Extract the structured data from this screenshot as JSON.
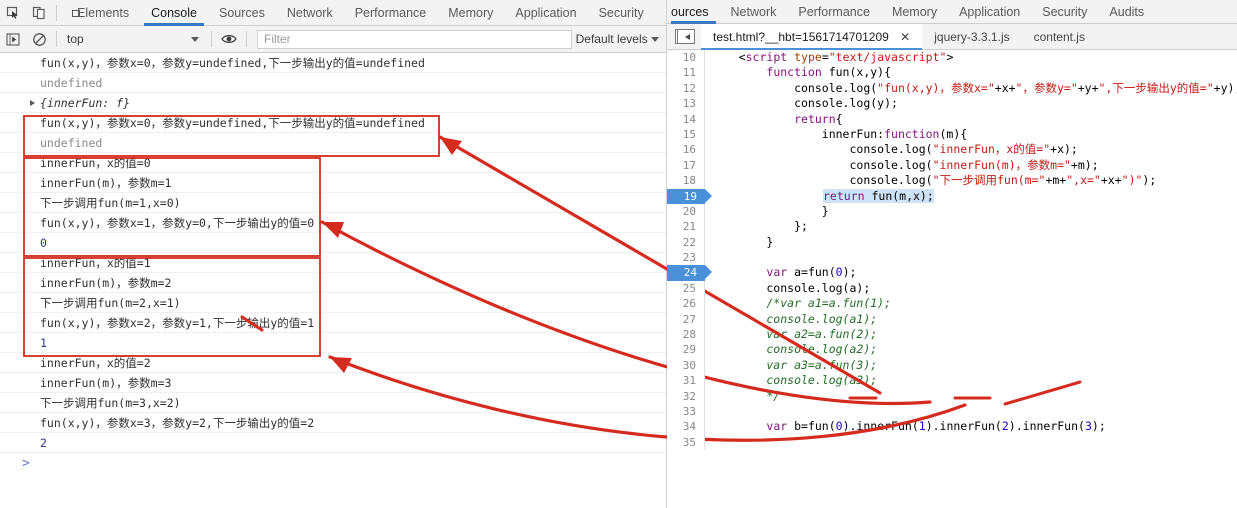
{
  "devtools": {
    "left_panel": {
      "toolbar_icons": [
        "inspect-element-icon",
        "device-toolbar-icon"
      ],
      "tabs": [
        {
          "label": "Elements",
          "active": false
        },
        {
          "label": "Console",
          "active": true
        },
        {
          "label": "Sources",
          "active": false
        },
        {
          "label": "Network",
          "active": false
        },
        {
          "label": "Performance",
          "active": false
        },
        {
          "label": "Memory",
          "active": false
        },
        {
          "label": "Application",
          "active": false
        },
        {
          "label": "Security",
          "active": false
        }
      ],
      "console_toolbar": {
        "context": "top",
        "filter_placeholder": "Filter",
        "filter_value": "",
        "levels": "Default levels"
      },
      "console_rows": [
        {
          "text": "fun(x,y)，参数x=0，参数y=undefined,下一步输出y的值=undefined",
          "kind": "log"
        },
        {
          "text": "undefined",
          "kind": "dim"
        },
        {
          "text": "{innerFun: f}",
          "kind": "object"
        },
        {
          "text": "fun(x,y)，参数x=0，参数y=undefined,下一步输出y的值=undefined",
          "kind": "log"
        },
        {
          "text": "undefined",
          "kind": "dim"
        },
        {
          "text": "innerFun，x的值=0",
          "kind": "log"
        },
        {
          "text": "innerFun(m)，参数m=1",
          "kind": "log"
        },
        {
          "text": "下一步调用fun(m=1,x=0)",
          "kind": "log"
        },
        {
          "text": "fun(x,y)，参数x=1，参数y=0,下一步输出y的值=0",
          "kind": "log"
        },
        {
          "text": "0",
          "kind": "value"
        },
        {
          "text": "innerFun，x的值=1",
          "kind": "log"
        },
        {
          "text": "innerFun(m)，参数m=2",
          "kind": "log"
        },
        {
          "text": "下一步调用fun(m=2,x=1)",
          "kind": "log"
        },
        {
          "text": "fun(x,y)，参数x=2，参数y=1,下一步输出y的值=1",
          "kind": "log"
        },
        {
          "text": "1",
          "kind": "value"
        },
        {
          "text": "innerFun，x的值=2",
          "kind": "log"
        },
        {
          "text": "innerFun(m)，参数m=3",
          "kind": "log"
        },
        {
          "text": "下一步调用fun(m=3,x=2)",
          "kind": "log"
        },
        {
          "text": "fun(x,y)，参数x=3，参数y=2,下一步输出y的值=2",
          "kind": "log"
        },
        {
          "text": "2",
          "kind": "value"
        }
      ],
      "console_prompt": ">"
    },
    "right_panel": {
      "tabs": [
        {
          "label": "ources",
          "active": true
        },
        {
          "label": "Network",
          "active": false
        },
        {
          "label": "Performance",
          "active": false
        },
        {
          "label": "Memory",
          "active": false
        },
        {
          "label": "Application",
          "active": false
        },
        {
          "label": "Security",
          "active": false
        },
        {
          "label": "Audits",
          "active": false
        }
      ],
      "file_tabs": [
        {
          "label": "test.html?__hbt=1561714701209",
          "active": true,
          "closable": true
        },
        {
          "label": "jquery-3.3.1.js",
          "active": false,
          "closable": false
        },
        {
          "label": "content.js",
          "active": false,
          "closable": false
        }
      ],
      "close_glyph": "✕",
      "code_lines": [
        {
          "n": "10",
          "text": "    <script type=\"text/javascript\">",
          "bp": false
        },
        {
          "n": "11",
          "text": "        function fun(x,y){",
          "bp": false
        },
        {
          "n": "12",
          "text": "            console.log(\"fun(x,y)，参数x=\"+x+\"，参数y=\"+y+\",下一步输出y的值=\"+y);",
          "bp": false
        },
        {
          "n": "13",
          "text": "            console.log(y);",
          "bp": false
        },
        {
          "n": "14",
          "text": "            return{",
          "bp": false
        },
        {
          "n": "15",
          "text": "                innerFun:function(m){",
          "bp": false
        },
        {
          "n": "16",
          "text": "                    console.log(\"innerFun，x的值=\"+x);",
          "bp": false
        },
        {
          "n": "17",
          "text": "                    console.log(\"innerFun(m)，参数m=\"+m);",
          "bp": false
        },
        {
          "n": "18",
          "text": "                    console.log(\"下一步调用fun(m=\"+m+\",x=\"+x+\")\");",
          "bp": false
        },
        {
          "n": "19",
          "text": "                    return fun(m,x);",
          "bp": true
        },
        {
          "n": "20",
          "text": "                }",
          "bp": false
        },
        {
          "n": "21",
          "text": "            };",
          "bp": false
        },
        {
          "n": "22",
          "text": "        }",
          "bp": false
        },
        {
          "n": "23",
          "text": "",
          "bp": false
        },
        {
          "n": "24",
          "text": "        var a=fun(0);",
          "bp": true
        },
        {
          "n": "25",
          "text": "        console.log(a);",
          "bp": false
        },
        {
          "n": "26",
          "text": "        /*var a1=a.fun(1);",
          "bp": false
        },
        {
          "n": "27",
          "text": "        console.log(a1);",
          "bp": false
        },
        {
          "n": "28",
          "text": "        var a2=a.fun(2);",
          "bp": false
        },
        {
          "n": "29",
          "text": "        console.log(a2);",
          "bp": false
        },
        {
          "n": "30",
          "text": "        var a3=a.fun(3);",
          "bp": false
        },
        {
          "n": "31",
          "text": "        console.log(a3);",
          "bp": false
        },
        {
          "n": "32",
          "text": "        */",
          "bp": false
        },
        {
          "n": "33",
          "text": "",
          "bp": false
        },
        {
          "n": "34",
          "text": "        var b=fun(0).innerFun(1).innerFun(2).innerFun(3);",
          "bp": false
        },
        {
          "n": "35",
          "text": "",
          "bp": false
        }
      ]
    }
  },
  "annotation": {
    "color": "#d52b1e",
    "box_count": 3,
    "arrow_count": 3
  }
}
